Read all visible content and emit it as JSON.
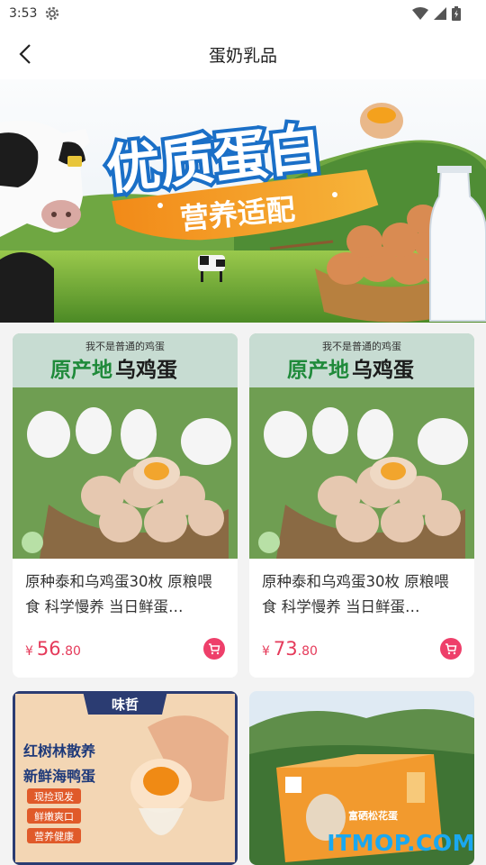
{
  "status_bar": {
    "time": "3:53"
  },
  "nav": {
    "title": "蛋奶乳品"
  },
  "banner": {
    "headline": "优质蛋白",
    "subline": "营养适配"
  },
  "products": [
    {
      "img_top": "我不是普通的鸡蛋",
      "img_headline_a": "原产地",
      "img_headline_b": "乌鸡蛋",
      "title": "原种泰和乌鸡蛋30枚 原粮喂食 科学慢养 当日鲜蛋…",
      "currency": "¥",
      "price_int": "56",
      "price_dec": ".80"
    },
    {
      "img_top": "我不是普通的鸡蛋",
      "img_headline_a": "原产地",
      "img_headline_b": "乌鸡蛋",
      "title": "原种泰和乌鸡蛋30枚 原粮喂食 科学慢养 当日鲜蛋…",
      "currency": "¥",
      "price_int": "73",
      "price_dec": ".80"
    },
    {
      "brand": "味哲",
      "tag_line1": "红树林散养",
      "tag_line2": "新鲜海鸭蛋",
      "badges": [
        "现捡现发",
        "鲜嫩爽口",
        "营养健康"
      ]
    },
    {
      "box_label": "富硒松花蛋"
    }
  ],
  "watermark": "ITMOP.COM",
  "colors": {
    "accent": "#e53a5a",
    "cart": "#ee3f6a",
    "watermark": "#1aa8f0"
  }
}
